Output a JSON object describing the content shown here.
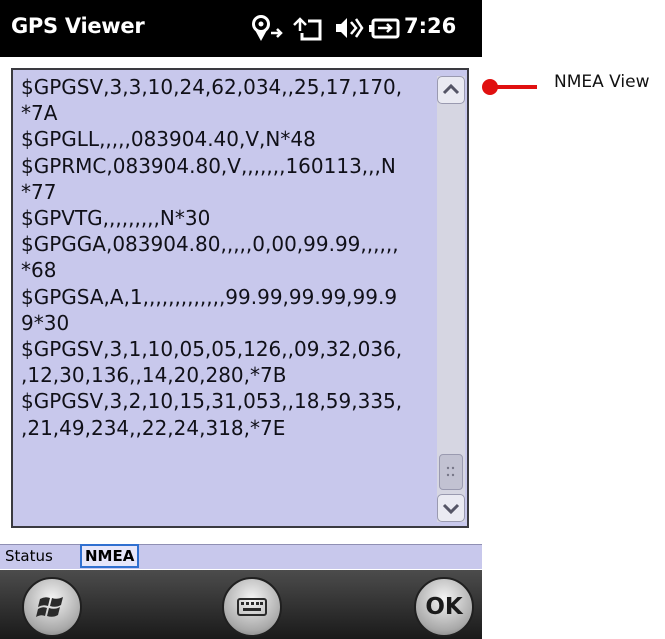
{
  "titlebar": {
    "app_title": "GPS Viewer",
    "clock": "7:26",
    "icons": [
      "gps-icon",
      "connection-icon",
      "volume-icon",
      "battery-icon"
    ]
  },
  "nmea_view": {
    "lines": [
      "$GPGSV,3,3,10,24,62,034,,25,17,170,",
      "*7A",
      "$GPGLL,,,,,083904.40,V,N*48",
      "$GPRMC,083904.80,V,,,,,,,160113,,,N",
      "*77",
      "$GPVTG,,,,,,,,,N*30",
      "$GPGGA,083904.80,,,,,0,00,99.99,,,,,,",
      "*68",
      "$GPGSA,A,1,,,,,,,,,,,,,99.99,99.99,99.9",
      "9*30",
      "$GPGSV,3,1,10,05,05,126,,09,32,036,",
      ",12,30,136,,14,20,280,*7B",
      "$GPGSV,3,2,10,15,31,053,,18,59,335,",
      ",21,49,234,,22,24,318,*7E"
    ]
  },
  "tabs": [
    {
      "label": "Status",
      "selected": false
    },
    {
      "label": "NMEA",
      "selected": true
    }
  ],
  "bottombar": {
    "ok_label": "OK"
  },
  "callout": {
    "label": "NMEA View",
    "color": "#e01010"
  },
  "colors": {
    "panel_bg": "#c8c8ec",
    "titlebar_bg": "#000000"
  }
}
